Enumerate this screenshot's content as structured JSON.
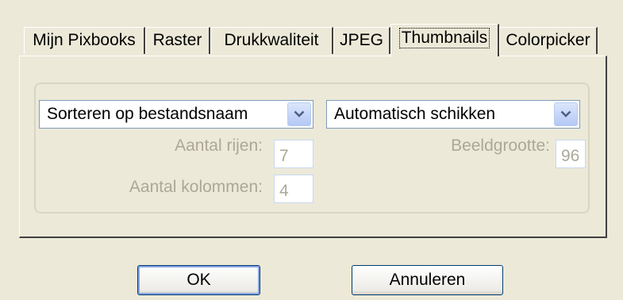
{
  "tabs": [
    {
      "label": "Mijn Pixbooks",
      "active": false
    },
    {
      "label": "Raster",
      "active": false
    },
    {
      "label": "Drukkwaliteit",
      "active": false
    },
    {
      "label": "JPEG",
      "active": false
    },
    {
      "label": "Thumbnails",
      "active": true
    },
    {
      "label": "Colorpicker",
      "active": false
    }
  ],
  "thumbnails": {
    "sort_select": {
      "value": "Sorteren op bestandsnaam",
      "icon": "chevron-down-icon"
    },
    "arrange_select": {
      "value": "Automatisch schikken",
      "icon": "chevron-down-icon"
    },
    "rows": {
      "label": "Aantal rijen:",
      "value": "7"
    },
    "columns": {
      "label": "Aantal kolommen:",
      "value": "4"
    },
    "image_size": {
      "label": "Beeldgrootte:",
      "value": "96"
    }
  },
  "buttons": {
    "ok": "OK",
    "cancel": "Annuleren"
  },
  "colors": {
    "window_bg": "#ECE9D8",
    "disabled_text": "#ACA899",
    "field_border": "#7F9DB9",
    "button_border": "#003C74"
  }
}
